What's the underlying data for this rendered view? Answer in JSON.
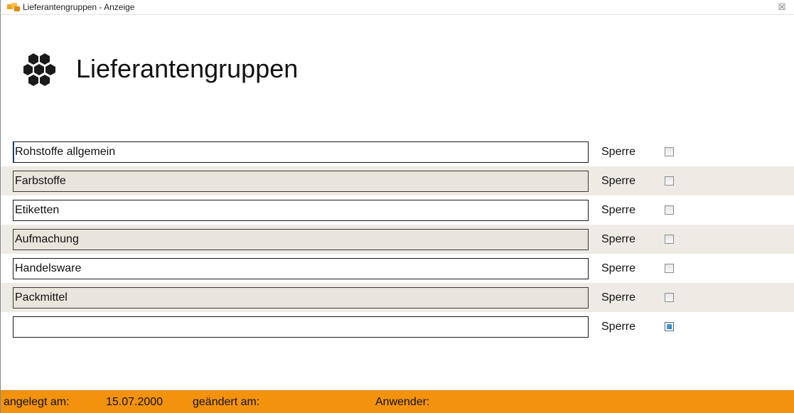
{
  "window": {
    "title": "Lieferantengruppen - Anzeige",
    "close_glyph": "☒"
  },
  "header": {
    "title": "Lieferantengruppen",
    "logo_icon": "hexagon-cluster-icon"
  },
  "rows": [
    {
      "value": "Rohstoffe allgemein",
      "lock_label": "Sperre",
      "lock_checked": false
    },
    {
      "value": "Farbstoffe",
      "lock_label": "Sperre",
      "lock_checked": false
    },
    {
      "value": "Etiketten",
      "lock_label": "Sperre",
      "lock_checked": false
    },
    {
      "value": "Aufmachung",
      "lock_label": "Sperre",
      "lock_checked": false
    },
    {
      "value": "Handelsware",
      "lock_label": "Sperre",
      "lock_checked": false
    },
    {
      "value": "Packmittel",
      "lock_label": "Sperre",
      "lock_checked": false
    },
    {
      "value": "",
      "lock_label": "Sperre",
      "lock_checked": false
    }
  ],
  "status": {
    "created_label": "angelegt am:",
    "created_value": "15.07.2000",
    "changed_label": "geändert am:",
    "changed_value": "",
    "user_label": "Anwender:",
    "user_value": ""
  },
  "colors": {
    "status_bar": "#f3920c",
    "alt_row": "#eeebe4"
  }
}
